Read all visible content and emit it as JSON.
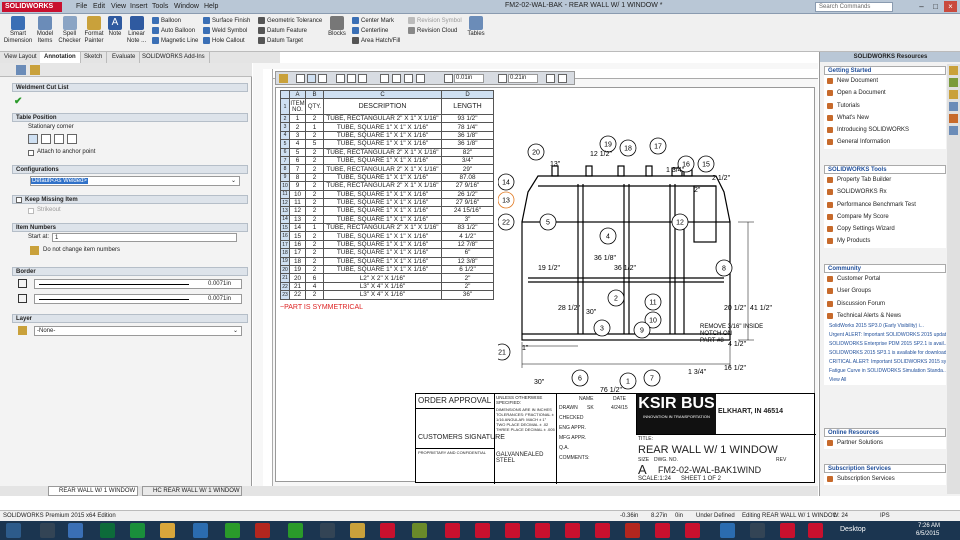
{
  "app": {
    "logo": "SOLIDWORKS",
    "title": "FM2-02-WAL-BAK - REAR WALL W/ 1 WINDOW *",
    "search": "Search Commands"
  },
  "menus": [
    "File",
    "Edit",
    "View",
    "Insert",
    "Tools",
    "Window",
    "Help"
  ],
  "ribbon": {
    "big": [
      "Smart Dimension",
      "Model Items",
      "Spell Checker",
      "Format Painter",
      "Note",
      "Linear Note ..."
    ],
    "col1": [
      "Balloon",
      "Auto Balloon",
      "Magnetic Line"
    ],
    "col2": [
      "Surface Finish",
      "Weld Symbol",
      "Hole Callout"
    ],
    "col3": [
      "Geometric Tolerance",
      "Datum Feature",
      "Datum Target"
    ],
    "blocks": "Blocks",
    "col4": [
      "Center Mark",
      "Centerline",
      "Area Hatch/Fill"
    ],
    "col5": [
      "Revision Symbol",
      "Revision Cloud"
    ],
    "tables": "Tables"
  },
  "cmd_tabs": [
    "View Layout",
    "Annotation",
    "Sketch",
    "Evaluate",
    "SOLIDWORKS Add-Ins"
  ],
  "pm": {
    "title": "Weldment Cut List",
    "table_position": "Table Position",
    "stationary_corner": "Stationary corner",
    "attach_anchor": "Attach to anchor point",
    "configurations": "Configurations",
    "config_value": "Default<As Welded>",
    "keep_missing": "Keep Missing Item",
    "strikeout": "Strikeout",
    "item_numbers": "Item Numbers",
    "start_at_label": "Start at:",
    "start_at": "1",
    "do_not_change": "Do not change item numbers",
    "border": "Border",
    "border1": "0.0071in",
    "border2": "0.0071in",
    "layer": "Layer",
    "layer_value": "-None-"
  },
  "fmt": {
    "h1": "0.01in",
    "h2": "0.21in"
  },
  "bom": {
    "cols": [
      "A",
      "B",
      "C",
      "D"
    ],
    "headers": [
      "ITEM NO.",
      "QTY.",
      "DESCRIPTION",
      "LENGTH"
    ],
    "rows": [
      [
        "1",
        "2",
        "TUBE, RECTANGULAR 2\" X 1\" X 1/16\"",
        "93 1/2\""
      ],
      [
        "2",
        "1",
        "TUBE, SQUARE 1\" X 1\" X 1/16\"",
        "78 1/4\""
      ],
      [
        "3",
        "2",
        "TUBE, SQUARE 1\" X 1\" X 1/16\"",
        "36 1/8\""
      ],
      [
        "4",
        "5",
        "TUBE, SQUARE 1\" X 1\" X 1/16\"",
        "36 1/8\""
      ],
      [
        "5",
        "2",
        "TUBE, RECTANGULAR 2\" X 1\" X 1/16\"",
        "82\""
      ],
      [
        "6",
        "2",
        "TUBE, SQUARE 1\" X 1\" X 1/16\"",
        "3/4\""
      ],
      [
        "7",
        "2",
        "TUBE, RECTANGULAR 2\" X 1\" X 1/16\"",
        "29\""
      ],
      [
        "8",
        "2",
        "TUBE, SQUARE 1\" X 1\" X 1/16\"",
        "87.08"
      ],
      [
        "9",
        "2",
        "TUBE, RECTANGULAR 2\" X 1\" X 1/16\"",
        "27 9/16\""
      ],
      [
        "10",
        "2",
        "TUBE, SQUARE 1\" X 1\" X 1/16\"",
        "26 1/2\""
      ],
      [
        "11",
        "2",
        "TUBE, SQUARE 1\" X 1\" X 1/16\"",
        "27 9/16\""
      ],
      [
        "12",
        "2",
        "TUBE, SQUARE 1\" X 1\" X 1/16\"",
        "24 15/16\""
      ],
      [
        "13",
        "2",
        "TUBE, SQUARE 1\" X 1\" X 1/16\"",
        "3\""
      ],
      [
        "14",
        "1",
        "TUBE, RECTANGULAR 2\" X 1\" X 1/16\"",
        "83 1/2\""
      ],
      [
        "15",
        "2",
        "TUBE, SQUARE 1\" X 1\" X 1/16\"",
        "4 1/2\""
      ],
      [
        "16",
        "2",
        "TUBE, SQUARE 1\" X 1\" X 1/16\"",
        "12 7/8\""
      ],
      [
        "17",
        "2",
        "TUBE, SQUARE 1\" X 1\" X 1/16\"",
        "6\""
      ],
      [
        "18",
        "2",
        "TUBE, SQUARE 1\" X 1\" X 1/16\"",
        "12 3/8\""
      ],
      [
        "19",
        "2",
        "TUBE, SQUARE 1\" X 1\" X 1/16\"",
        "6 1/2\""
      ],
      [
        "20",
        "6",
        "L2\" X 2\" X 1/16\"",
        "2\""
      ],
      [
        "21",
        "4",
        "L3\" X 4\" X 1/16\"",
        "2\""
      ],
      [
        "22",
        "2",
        "L3\" X 4\" X 1/16\"",
        "36\""
      ]
    ],
    "note": "~PART IS SYMMETRICAL"
  },
  "drawing": {
    "balloons": [
      "20",
      "19",
      "18",
      "17",
      "16",
      "15",
      "14",
      "13",
      "22",
      "5",
      "4",
      "12",
      "8",
      "2",
      "11",
      "10",
      "9",
      "3",
      "21",
      "6",
      "1",
      "7"
    ],
    "dims": [
      "13\"",
      "12 1/2\"",
      "1 3/4\"",
      "2 1/2\"",
      "36 1/8\"",
      "36 1/2\"",
      "19 1/2\"",
      "30\"",
      "28 1/2\"",
      "41 1/2\"",
      "20 1/2\"",
      "REMOVE 3/16\" INSIDE NOTCH ON PART #8",
      "16 1/2\"",
      "30\"",
      "4 1/2\"",
      "1 3/4\"",
      "76 1/2\"",
      "2\"",
      "1\""
    ]
  },
  "titleblock": {
    "order_approval": "ORDER APPROVAL",
    "customers_signature": "CUSTOMERS SIGNATURE",
    "unless": "UNLESS OTHERWISE SPECIFIED:",
    "dims_in": "DIMENSIONS ARE IN INCHES TOLERANCES: FRACTIONAL ± 1/16 ANGULAR: MACH ± 1° TWO PLACE DECIMAL ± .02 THREE PLACE DECIMAL ± .005",
    "material": "GALVANNEALED STEEL",
    "name": "NAME",
    "date": "DATE",
    "drawn": "DRAWN",
    "drawn_by": "SK",
    "drawn_date": "4/24/15",
    "checked": "CHECKED",
    "eng_appr": "ENG APPR.",
    "mfg_appr": "MFG APPR.",
    "qa": "Q.A.",
    "comments": "COMMENTS:",
    "company": "ELKHART, IN 46514",
    "logo_text": "KSIR BUS",
    "logo_sub": "INNOVATION IN TRANSPORTATION",
    "title_lbl": "TITLE:",
    "title": "REAR WALL W/ 1 WINDOW",
    "size_lbl": "SIZE",
    "dwg_lbl": "DWG. NO.",
    "rev_lbl": "REV",
    "size": "A",
    "dwg_no": "FM2-02-WAL-BAK1WIND",
    "scale": "SCALE:1:24",
    "sheet": "SHEET 1 OF 2",
    "proprietary": "PROPRIETARY AND CONFIDENTIAL"
  },
  "resources": {
    "title": "SOLIDWORKS Resources",
    "getting_started": {
      "title": "Getting Started",
      "items": [
        "New Document",
        "Open a Document",
        "Tutorials",
        "What's New",
        "Introducing SOLIDWORKS",
        "General Information"
      ]
    },
    "tools": {
      "title": "SOLIDWORKS Tools",
      "items": [
        "Property Tab Builder",
        "SOLIDWORKS Rx",
        "Performance Benchmark Test",
        "Compare My Score",
        "Copy Settings Wizard",
        "My Products"
      ]
    },
    "community": {
      "title": "Community",
      "items": [
        "Customer Portal",
        "User Groups",
        "Discussion Forum",
        "Technical Alerts & News"
      ]
    },
    "news": [
      "SolidWorks 2015 SP3.0 (Early Visibility) i...",
      "Urgent ALERT: Important SOLIDWORKS 2015 updat...",
      "SOLIDWORKS Enterprise PDM 2015 SP2.1 is avail...",
      "SOLIDWORKS 2015 SP3.1 is available for download",
      "CRITICAL ALERT: Important SOLIDWORKS 2015 syst...",
      "Fatigue Curve in SOLIDWORKS Simulation Standa..."
    ],
    "view_all": "View All",
    "online": {
      "title": "Online Resources",
      "items": [
        "Partner Solutions"
      ]
    },
    "subscription": {
      "title": "Subscription Services",
      "items": [
        "Subscription Services"
      ]
    }
  },
  "doc_tabs": [
    "REAR WALL W/ 1 WINDOW",
    "HC REAR WALL W/ 1 WINDOW"
  ],
  "status": {
    "left": "SOLIDWORKS Premium 2015 x64 Edition",
    "x": "-0.36in",
    "y": "8.27in",
    "z": "0in",
    "def": "Under Defined",
    "editing": "Editing REAR WALL W/ 1 WINDOW",
    "scale": "1 : 24",
    "ips": "IPS"
  },
  "taskbar": {
    "desktop": "Desktop",
    "time": "7:26 AM",
    "date": "6/5/2015"
  }
}
